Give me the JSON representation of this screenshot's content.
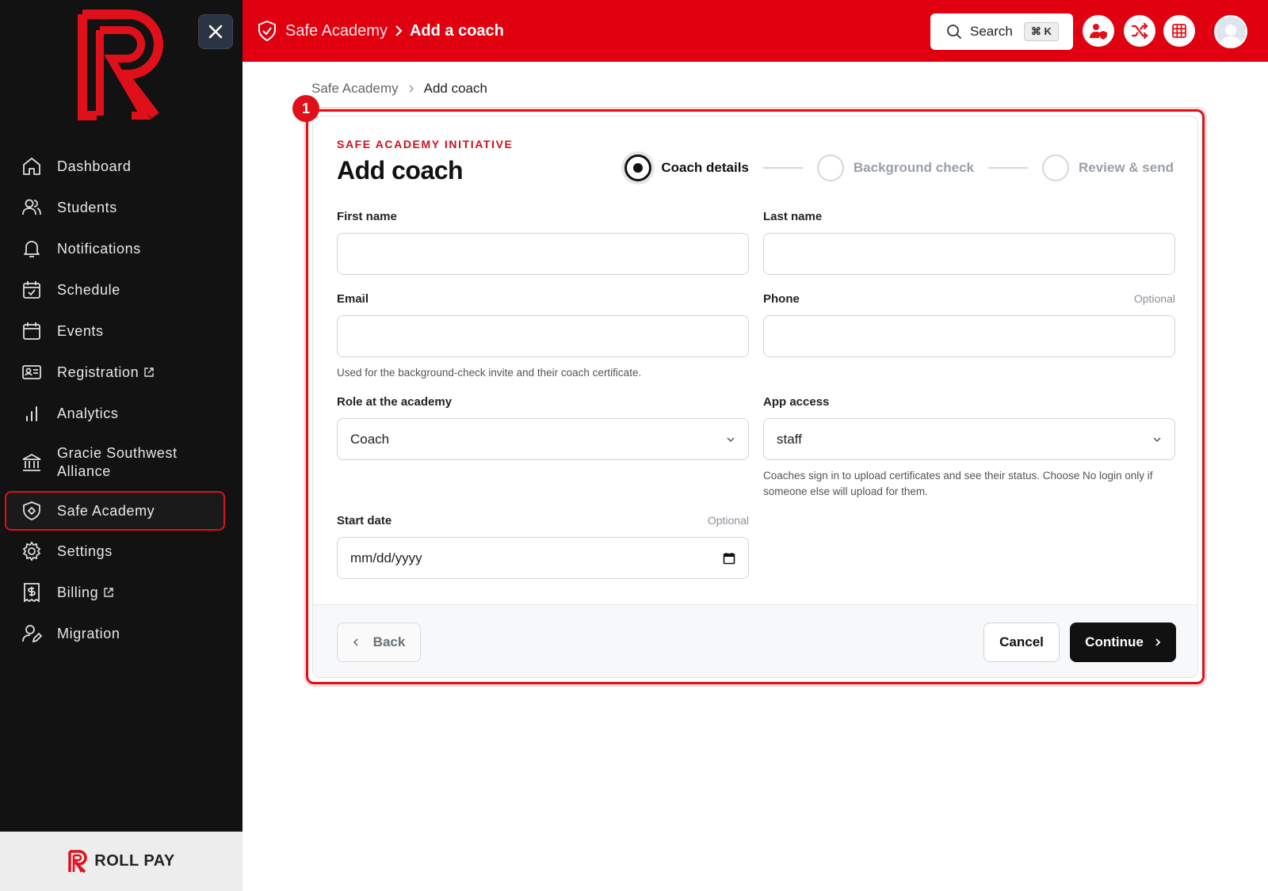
{
  "sidebar": {
    "close_label": "close",
    "items": [
      {
        "label": "Dashboard",
        "icon": "home-icon"
      },
      {
        "label": "Students",
        "icon": "users-icon"
      },
      {
        "label": "Notifications",
        "icon": "bell-icon"
      },
      {
        "label": "Schedule",
        "icon": "calendar-check-icon"
      },
      {
        "label": "Events",
        "icon": "calendar-icon"
      },
      {
        "label": "Registration",
        "icon": "id-card-icon"
      },
      {
        "label": "Analytics",
        "icon": "bar-chart-icon"
      },
      {
        "label": "Gracie Southwest Alliance",
        "icon": "bank-icon"
      },
      {
        "label": "Safe Academy",
        "icon": "shield-icon"
      },
      {
        "label": "Settings",
        "icon": "gear-icon"
      },
      {
        "label": "Billing",
        "icon": "billing-icon"
      },
      {
        "label": "Migration",
        "icon": "user-edit-icon"
      }
    ],
    "footer_brand": "ROLL PAY"
  },
  "topbar": {
    "crumb_parent": "Safe Academy",
    "crumb_current": "Add a coach",
    "search_label": "Search",
    "search_shortcut": "⌘ K",
    "colors": {
      "brand": "#e0000f"
    }
  },
  "breadcrumb": {
    "parent": "Safe Academy",
    "current": "Add coach"
  },
  "annotation": {
    "badge": "1"
  },
  "form": {
    "eyebrow": "SAFE ACADEMY INITIATIVE",
    "title": "Add coach",
    "steps": [
      {
        "label": "Coach details",
        "state": "active"
      },
      {
        "label": "Background check",
        "state": "inactive"
      },
      {
        "label": "Review & send",
        "state": "inactive"
      }
    ],
    "first_name": {
      "label": "First name",
      "value": ""
    },
    "last_name": {
      "label": "Last name",
      "value": ""
    },
    "email": {
      "label": "Email",
      "value": "",
      "hint": "Used for the background-check invite and their coach certificate."
    },
    "phone": {
      "label": "Phone",
      "optional": "Optional",
      "value": ""
    },
    "role": {
      "label": "Role at the academy",
      "value": "Coach"
    },
    "app_access": {
      "label": "App access",
      "value": "staff",
      "hint": "Coaches sign in to upload certificates and see their status. Choose No login only if someone else will upload for them."
    },
    "start_date": {
      "label": "Start date",
      "optional": "Optional",
      "placeholder": "mm/dd/yyyy"
    },
    "back_label": "Back",
    "cancel_label": "Cancel",
    "continue_label": "Continue"
  }
}
